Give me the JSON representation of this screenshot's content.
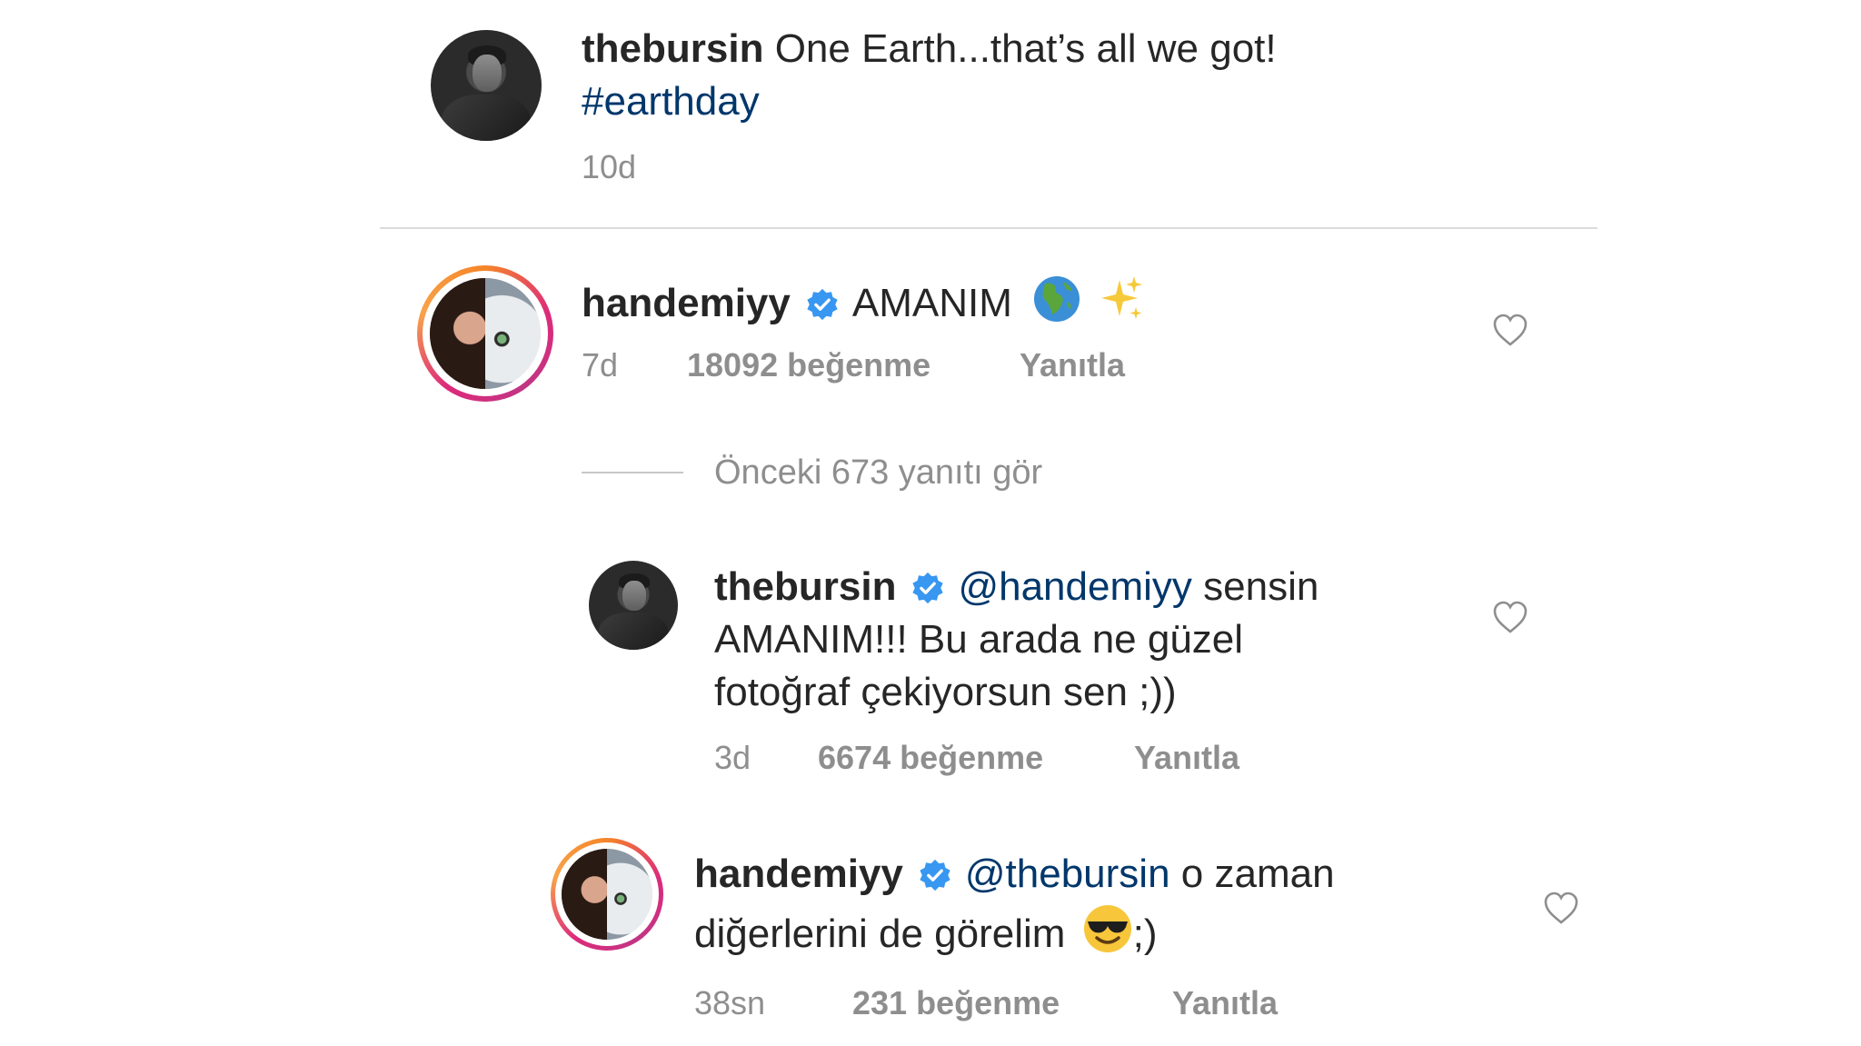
{
  "caption": {
    "username": "thebursin",
    "text": "One Earth...that’s all we got!",
    "hashtag": "#earthday",
    "time": "10d"
  },
  "comments": [
    {
      "username": "handemiyy",
      "verified": true,
      "text": "AMANIM",
      "emojis": [
        "globe-europe-africa-emoji",
        "sparkles-emoji"
      ],
      "time": "7d",
      "likes": "18092 beğenme",
      "reply_label": "Yanıtla"
    }
  ],
  "view_replies": "Önceki 673 yanıtı gör",
  "replies": [
    {
      "username": "thebursin",
      "verified": true,
      "mention": "@handemiyy",
      "text_line1": "sensin",
      "text_line2": "AMANIM!!! Bu arada ne güzel",
      "text_line3": "fotoğraf çekiyorsun sen ;))",
      "time": "3d",
      "likes": "6674 beğenme",
      "reply_label": "Yanıtla"
    },
    {
      "username": "handemiyy",
      "verified": true,
      "mention": "@thebursin",
      "text_line1": "o zaman",
      "text_line2": "diğerlerini de görelim",
      "text_line2_suffix": ";)",
      "emoji": "smiling-face-with-sunglasses-emoji",
      "time": "38sn",
      "likes": "231 beğenme",
      "reply_label": "Yanıtla"
    }
  ],
  "colors": {
    "link": "#00376b",
    "verified": "#3897f0",
    "meta": "#8e8e8e",
    "divider": "#dbdbdb"
  }
}
